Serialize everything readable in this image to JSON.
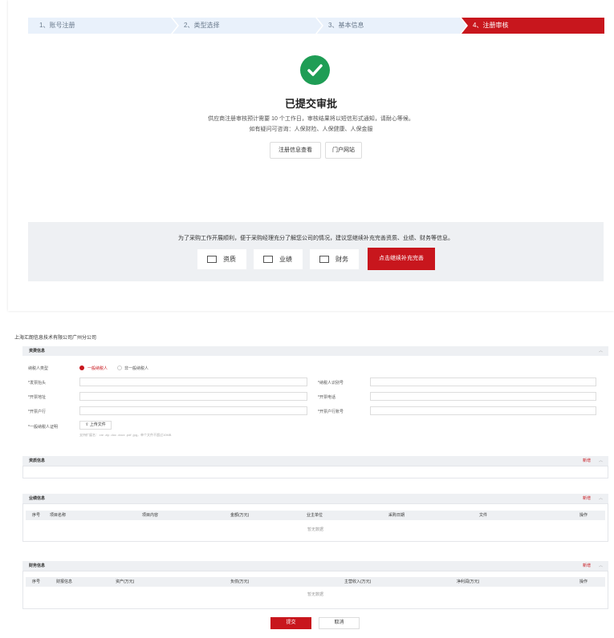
{
  "steps": [
    "1、账号注册",
    "2、类型选择",
    "3、基本信息",
    "4、注册审核"
  ],
  "status": {
    "title": "已提交审批",
    "line1": "供应商注册审核预计需要 10 个工作日，审核结果将以短信形式通知，请耐心等候。",
    "line2": "如有疑问可咨询：人保财险、人保健康、人保金服",
    "view_button": "注册信息查看",
    "portal_button": "门户网站"
  },
  "supplement": {
    "message": "为了采购工作开展顺利，便于采购经理充分了解您公司的情况，建议您继续补充完善资质、业绩、财务等信息。",
    "items": [
      "资质",
      "业绩",
      "财务"
    ],
    "cta": "点击继续补充完善"
  },
  "form": {
    "company": "上海汇朗信息技术有限公司广州分公司",
    "basic_section": "资费信息",
    "taxpayer_type_label": "纳税人类型",
    "taxpayer_options": [
      "一般纳税人",
      "非一般纳税人"
    ],
    "fields_left": [
      "*发票抬头",
      "*开票地址",
      "*开票户行"
    ],
    "fields_right": [
      "*纳税人识别号",
      "*开票电话",
      "*开票户行账号"
    ],
    "cert_label": "*一般纳税人证明",
    "upload_button": "上传文件",
    "upload_hint": "支持扩展名：.rar .zip .doc .docx .pdf .jpg，单个文件不超过10MB",
    "qualification_section": "资质信息",
    "performance_section": "业绩信息",
    "finance_section": "财务信息",
    "add_label": "新增",
    "performance_columns": [
      "序号",
      "项目名称",
      "项目内容",
      "金额(万元)",
      "业主单位",
      "采购日期",
      "文件",
      "操作"
    ],
    "finance_columns": [
      "序号",
      "财报信息",
      "资产(万元)",
      "负债(万元)",
      "主营收入(万元)",
      "净利润(万元)",
      "操作"
    ],
    "empty_text": "暂无数据",
    "submit": "提交",
    "cancel": "取消"
  }
}
